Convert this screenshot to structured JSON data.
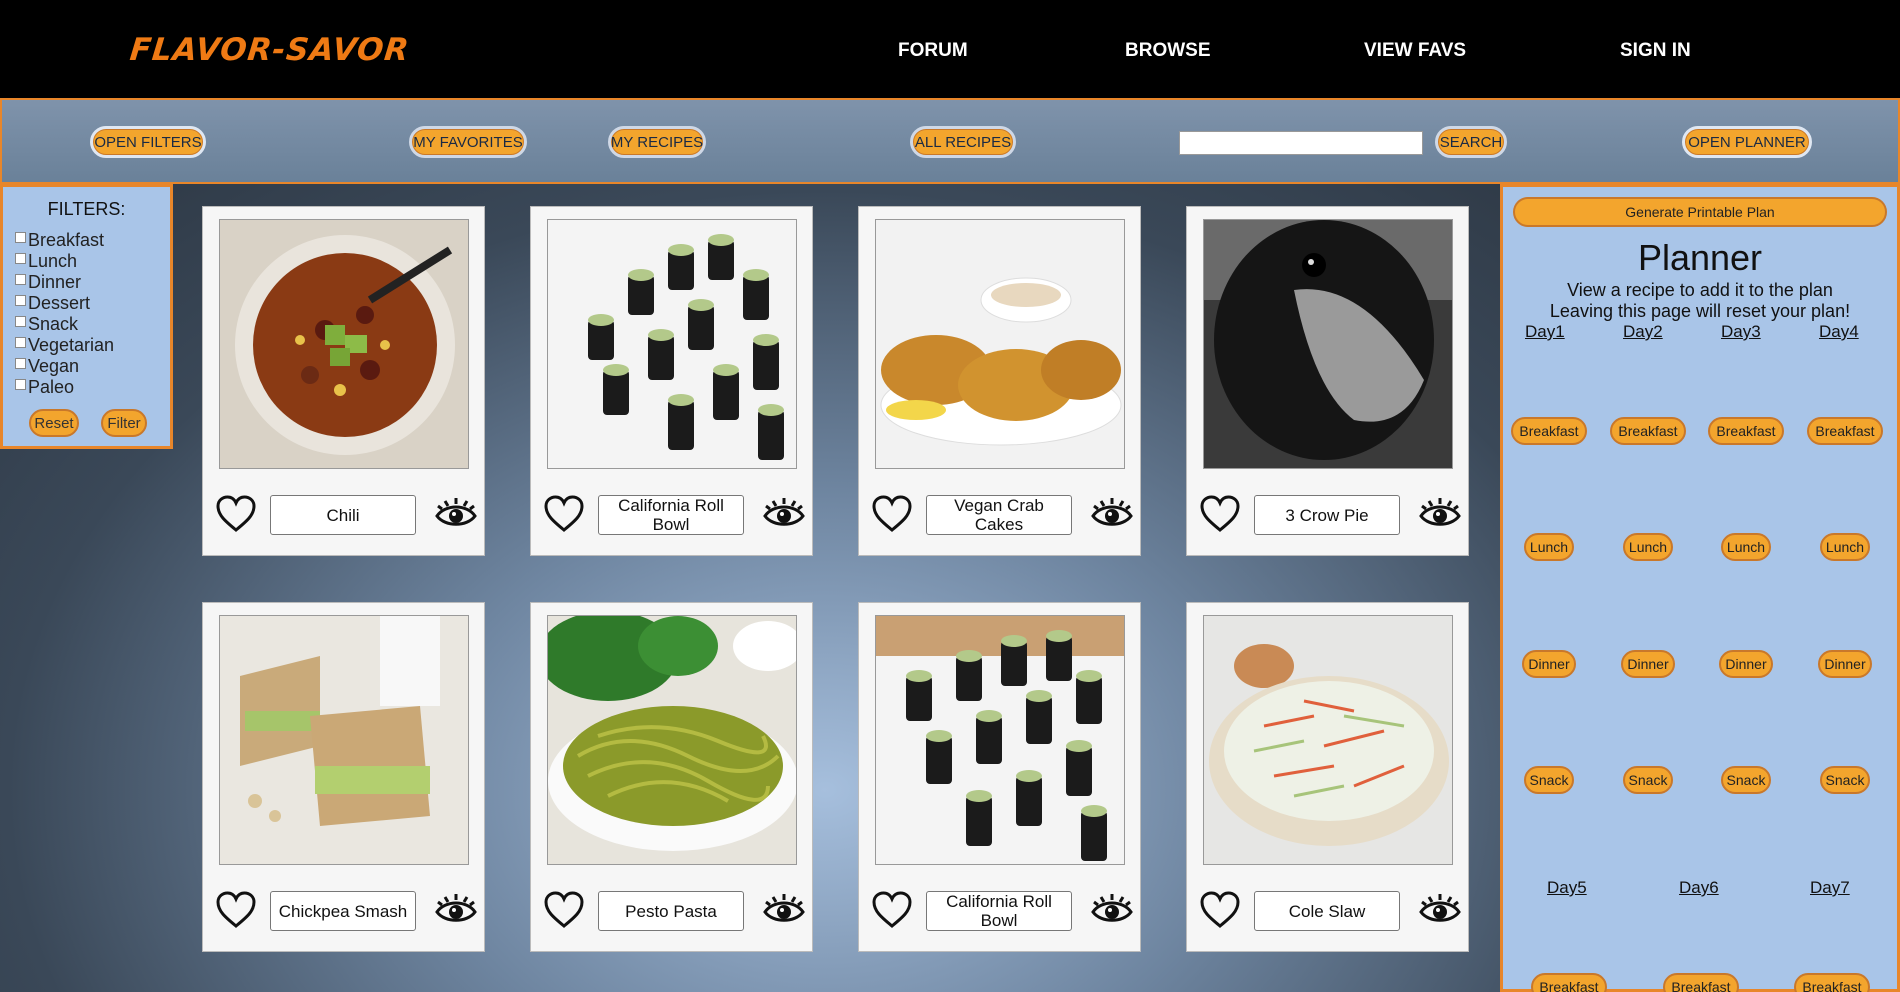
{
  "brand": "FLAVOR-SAVOR",
  "nav": {
    "forum": "FORUM",
    "browse": "BROWSE",
    "favs": "VIEW FAVS",
    "signin": "SIGN IN"
  },
  "toolbar": {
    "open_filters": "OPEN FILTERS",
    "my_favorites": "MY FAVORITES",
    "my_recipes": "MY RECIPES",
    "all_recipes": "ALL RECIPES",
    "search_value": "",
    "search": "SEARCH",
    "open_planner": "OPEN PLANNER"
  },
  "filters": {
    "title": "FILTERS:",
    "options": [
      "Breakfast",
      "Lunch",
      "Dinner",
      "Dessert",
      "Snack",
      "Vegetarian",
      "Vegan",
      "Paleo"
    ],
    "reset": "Reset",
    "filter": "Filter"
  },
  "recipes": [
    {
      "name": "Chili",
      "image": "chili bowl"
    },
    {
      "name": "California Roll Bowl",
      "image": "sushi rolls"
    },
    {
      "name": "Vegan Crab Cakes",
      "image": "crab cakes"
    },
    {
      "name": "3 Crow Pie",
      "image": "crow"
    },
    {
      "name": "Chickpea Smash",
      "image": "sandwich"
    },
    {
      "name": "Pesto Pasta",
      "image": "pesto pasta"
    },
    {
      "name": "California Roll Bowl",
      "image": "sushi rolls"
    },
    {
      "name": "Cole Slaw",
      "image": "cole slaw"
    }
  ],
  "planner": {
    "generate": "Generate Printable Plan",
    "title": "Planner",
    "sub1": "View a recipe to add it to the plan",
    "sub2": "Leaving this page will reset your plan!",
    "days_row1": [
      "Day1",
      "Day2",
      "Day3",
      "Day4"
    ],
    "days_row2": [
      "Day5",
      "Day6",
      "Day7"
    ],
    "meals": [
      "Breakfast",
      "Lunch",
      "Dinner",
      "Snack"
    ]
  },
  "colors": {
    "accent": "#f3a52d",
    "brand": "#ef7a14",
    "panel": "#a9c5e8",
    "border": "#e8862a"
  }
}
